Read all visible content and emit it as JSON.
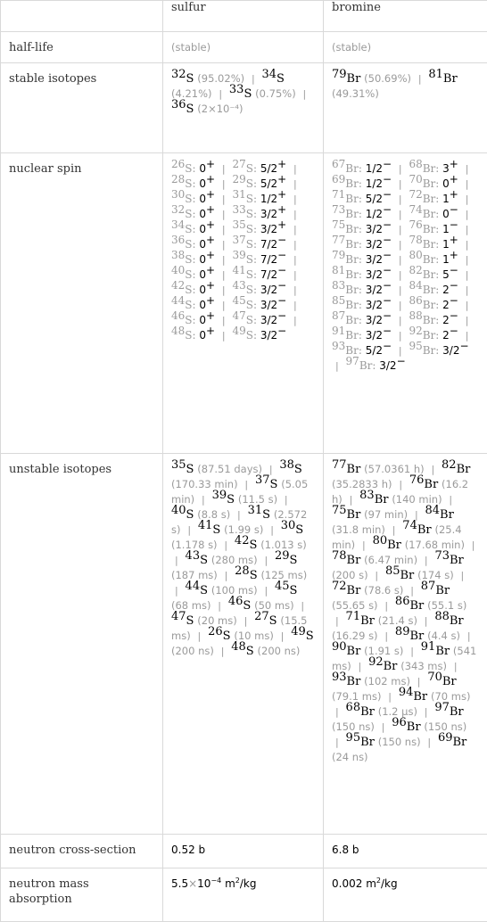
{
  "columns": [
    "",
    "sulfur",
    "bromine"
  ],
  "rows": {
    "half_life": {
      "label": "half-life",
      "sulfur": "(stable)",
      "bromine": "(stable)"
    },
    "stable_isotopes": {
      "label": "stable isotopes",
      "sulfur": [
        {
          "mass": "32",
          "symbol": "S",
          "value": "(95.02%)"
        },
        {
          "mass": "34",
          "symbol": "S",
          "value": "(4.21%)"
        },
        {
          "mass": "33",
          "symbol": "S",
          "value": "(0.75%)"
        },
        {
          "mass": "36",
          "symbol": "S",
          "value": "(2×10⁻⁴)"
        }
      ],
      "bromine": [
        {
          "mass": "79",
          "symbol": "Br",
          "value": "(50.69%)"
        },
        {
          "mass": "81",
          "symbol": "Br",
          "value": "(49.31%)"
        }
      ]
    },
    "nuclear_spin": {
      "label": "nuclear spin",
      "sulfur": [
        {
          "mass": "26",
          "symbol": "S",
          "spin": "0",
          "parity": "+"
        },
        {
          "mass": "27",
          "symbol": "S",
          "spin": "5/2",
          "parity": "+"
        },
        {
          "mass": "28",
          "symbol": "S",
          "spin": "0",
          "parity": "+"
        },
        {
          "mass": "29",
          "symbol": "S",
          "spin": "5/2",
          "parity": "+"
        },
        {
          "mass": "30",
          "symbol": "S",
          "spin": "0",
          "parity": "+"
        },
        {
          "mass": "31",
          "symbol": "S",
          "spin": "1/2",
          "parity": "+"
        },
        {
          "mass": "32",
          "symbol": "S",
          "spin": "0",
          "parity": "+"
        },
        {
          "mass": "33",
          "symbol": "S",
          "spin": "3/2",
          "parity": "+"
        },
        {
          "mass": "34",
          "symbol": "S",
          "spin": "0",
          "parity": "+"
        },
        {
          "mass": "35",
          "symbol": "S",
          "spin": "3/2",
          "parity": "+"
        },
        {
          "mass": "36",
          "symbol": "S",
          "spin": "0",
          "parity": "+"
        },
        {
          "mass": "37",
          "symbol": "S",
          "spin": "7/2",
          "parity": "−"
        },
        {
          "mass": "38",
          "symbol": "S",
          "spin": "0",
          "parity": "+"
        },
        {
          "mass": "39",
          "symbol": "S",
          "spin": "7/2",
          "parity": "−"
        },
        {
          "mass": "40",
          "symbol": "S",
          "spin": "0",
          "parity": "+"
        },
        {
          "mass": "41",
          "symbol": "S",
          "spin": "7/2",
          "parity": "−"
        },
        {
          "mass": "42",
          "symbol": "S",
          "spin": "0",
          "parity": "+"
        },
        {
          "mass": "43",
          "symbol": "S",
          "spin": "3/2",
          "parity": "−"
        },
        {
          "mass": "44",
          "symbol": "S",
          "spin": "0",
          "parity": "+"
        },
        {
          "mass": "45",
          "symbol": "S",
          "spin": "3/2",
          "parity": "−"
        },
        {
          "mass": "46",
          "symbol": "S",
          "spin": "0",
          "parity": "+"
        },
        {
          "mass": "47",
          "symbol": "S",
          "spin": "3/2",
          "parity": "−"
        },
        {
          "mass": "48",
          "symbol": "S",
          "spin": "0",
          "parity": "+"
        },
        {
          "mass": "49",
          "symbol": "S",
          "spin": "3/2",
          "parity": "−"
        }
      ],
      "bromine": [
        {
          "mass": "67",
          "symbol": "Br",
          "spin": "1/2",
          "parity": "−"
        },
        {
          "mass": "68",
          "symbol": "Br",
          "spin": "3",
          "parity": "+"
        },
        {
          "mass": "69",
          "symbol": "Br",
          "spin": "1/2",
          "parity": "−"
        },
        {
          "mass": "70",
          "symbol": "Br",
          "spin": "0",
          "parity": "+"
        },
        {
          "mass": "71",
          "symbol": "Br",
          "spin": "5/2",
          "parity": "−"
        },
        {
          "mass": "72",
          "symbol": "Br",
          "spin": "1",
          "parity": "+"
        },
        {
          "mass": "73",
          "symbol": "Br",
          "spin": "1/2",
          "parity": "−"
        },
        {
          "mass": "74",
          "symbol": "Br",
          "spin": "0",
          "parity": "−"
        },
        {
          "mass": "75",
          "symbol": "Br",
          "spin": "3/2",
          "parity": "−"
        },
        {
          "mass": "76",
          "symbol": "Br",
          "spin": "1",
          "parity": "−"
        },
        {
          "mass": "77",
          "symbol": "Br",
          "spin": "3/2",
          "parity": "−"
        },
        {
          "mass": "78",
          "symbol": "Br",
          "spin": "1",
          "parity": "+"
        },
        {
          "mass": "79",
          "symbol": "Br",
          "spin": "3/2",
          "parity": "−"
        },
        {
          "mass": "80",
          "symbol": "Br",
          "spin": "1",
          "parity": "+"
        },
        {
          "mass": "81",
          "symbol": "Br",
          "spin": "3/2",
          "parity": "−"
        },
        {
          "mass": "82",
          "symbol": "Br",
          "spin": "5",
          "parity": "−"
        },
        {
          "mass": "83",
          "symbol": "Br",
          "spin": "3/2",
          "parity": "−"
        },
        {
          "mass": "84",
          "symbol": "Br",
          "spin": "2",
          "parity": "−"
        },
        {
          "mass": "85",
          "symbol": "Br",
          "spin": "3/2",
          "parity": "−"
        },
        {
          "mass": "86",
          "symbol": "Br",
          "spin": "2",
          "parity": "−"
        },
        {
          "mass": "87",
          "symbol": "Br",
          "spin": "3/2",
          "parity": "−"
        },
        {
          "mass": "88",
          "symbol": "Br",
          "spin": "2",
          "parity": "−"
        },
        {
          "mass": "91",
          "symbol": "Br",
          "spin": "3/2",
          "parity": "−"
        },
        {
          "mass": "92",
          "symbol": "Br",
          "spin": "2",
          "parity": "−"
        },
        {
          "mass": "93",
          "symbol": "Br",
          "spin": "5/2",
          "parity": "−"
        },
        {
          "mass": "95",
          "symbol": "Br",
          "spin": "3/2",
          "parity": "−"
        },
        {
          "mass": "97",
          "symbol": "Br",
          "spin": "3/2",
          "parity": "−"
        }
      ]
    },
    "unstable_isotopes": {
      "label": "unstable isotopes",
      "sulfur": [
        {
          "mass": "35",
          "symbol": "S",
          "value": "(87.51 days)"
        },
        {
          "mass": "38",
          "symbol": "S",
          "value": "(170.33 min)"
        },
        {
          "mass": "37",
          "symbol": "S",
          "value": "(5.05 min)"
        },
        {
          "mass": "39",
          "symbol": "S",
          "value": "(11.5 s)"
        },
        {
          "mass": "40",
          "symbol": "S",
          "value": "(8.8 s)"
        },
        {
          "mass": "31",
          "symbol": "S",
          "value": "(2.572 s)"
        },
        {
          "mass": "41",
          "symbol": "S",
          "value": "(1.99 s)"
        },
        {
          "mass": "30",
          "symbol": "S",
          "value": "(1.178 s)"
        },
        {
          "mass": "42",
          "symbol": "S",
          "value": "(1.013 s)"
        },
        {
          "mass": "43",
          "symbol": "S",
          "value": "(280 ms)"
        },
        {
          "mass": "29",
          "symbol": "S",
          "value": "(187 ms)"
        },
        {
          "mass": "28",
          "symbol": "S",
          "value": "(125 ms)"
        },
        {
          "mass": "44",
          "symbol": "S",
          "value": "(100 ms)"
        },
        {
          "mass": "45",
          "symbol": "S",
          "value": "(68 ms)"
        },
        {
          "mass": "46",
          "symbol": "S",
          "value": "(50 ms)"
        },
        {
          "mass": "47",
          "symbol": "S",
          "value": "(20 ms)"
        },
        {
          "mass": "27",
          "symbol": "S",
          "value": "(15.5 ms)"
        },
        {
          "mass": "26",
          "symbol": "S",
          "value": "(10 ms)"
        },
        {
          "mass": "49",
          "symbol": "S",
          "value": "(200 ns)"
        },
        {
          "mass": "48",
          "symbol": "S",
          "value": "(200 ns)"
        }
      ],
      "bromine": [
        {
          "mass": "77",
          "symbol": "Br",
          "value": "(57.0361 h)"
        },
        {
          "mass": "82",
          "symbol": "Br",
          "value": "(35.2833 h)"
        },
        {
          "mass": "76",
          "symbol": "Br",
          "value": "(16.2 h)"
        },
        {
          "mass": "83",
          "symbol": "Br",
          "value": "(140 min)"
        },
        {
          "mass": "75",
          "symbol": "Br",
          "value": "(97 min)"
        },
        {
          "mass": "84",
          "symbol": "Br",
          "value": "(31.8 min)"
        },
        {
          "mass": "74",
          "symbol": "Br",
          "value": "(25.4 min)"
        },
        {
          "mass": "80",
          "symbol": "Br",
          "value": "(17.68 min)"
        },
        {
          "mass": "78",
          "symbol": "Br",
          "value": "(6.47 min)"
        },
        {
          "mass": "73",
          "symbol": "Br",
          "value": "(200 s)"
        },
        {
          "mass": "85",
          "symbol": "Br",
          "value": "(174 s)"
        },
        {
          "mass": "72",
          "symbol": "Br",
          "value": "(78.6 s)"
        },
        {
          "mass": "87",
          "symbol": "Br",
          "value": "(55.65 s)"
        },
        {
          "mass": "86",
          "symbol": "Br",
          "value": "(55.1 s)"
        },
        {
          "mass": "71",
          "symbol": "Br",
          "value": "(21.4 s)"
        },
        {
          "mass": "88",
          "symbol": "Br",
          "value": "(16.29 s)"
        },
        {
          "mass": "89",
          "symbol": "Br",
          "value": "(4.4 s)"
        },
        {
          "mass": "90",
          "symbol": "Br",
          "value": "(1.91 s)"
        },
        {
          "mass": "91",
          "symbol": "Br",
          "value": "(541 ms)"
        },
        {
          "mass": "92",
          "symbol": "Br",
          "value": "(343 ms)"
        },
        {
          "mass": "93",
          "symbol": "Br",
          "value": "(102 ms)"
        },
        {
          "mass": "70",
          "symbol": "Br",
          "value": "(79.1 ms)"
        },
        {
          "mass": "94",
          "symbol": "Br",
          "value": "(70 ms)"
        },
        {
          "mass": "68",
          "symbol": "Br",
          "value": "(1.2 µs)"
        },
        {
          "mass": "97",
          "symbol": "Br",
          "value": "(150 ns)"
        },
        {
          "mass": "96",
          "symbol": "Br",
          "value": "(150 ns)"
        },
        {
          "mass": "95",
          "symbol": "Br",
          "value": "(150 ns)"
        },
        {
          "mass": "69",
          "symbol": "Br",
          "value": "(24 ns)"
        }
      ]
    },
    "neutron_cross_section": {
      "label": "neutron cross-section",
      "sulfur": "0.52 b",
      "bromine": "6.8 b"
    },
    "neutron_mass_absorption": {
      "label": "neutron mass absorption",
      "sulfur": {
        "mantissa": "5.5",
        "times": "×",
        "base": "10",
        "exponent": "−4",
        "unit": "m",
        "unit_exp": "2",
        "unit_rest": "/kg"
      },
      "bromine": {
        "value": "0.002",
        "unit": "m",
        "unit_exp": "2",
        "unit_rest": "/kg"
      }
    }
  }
}
